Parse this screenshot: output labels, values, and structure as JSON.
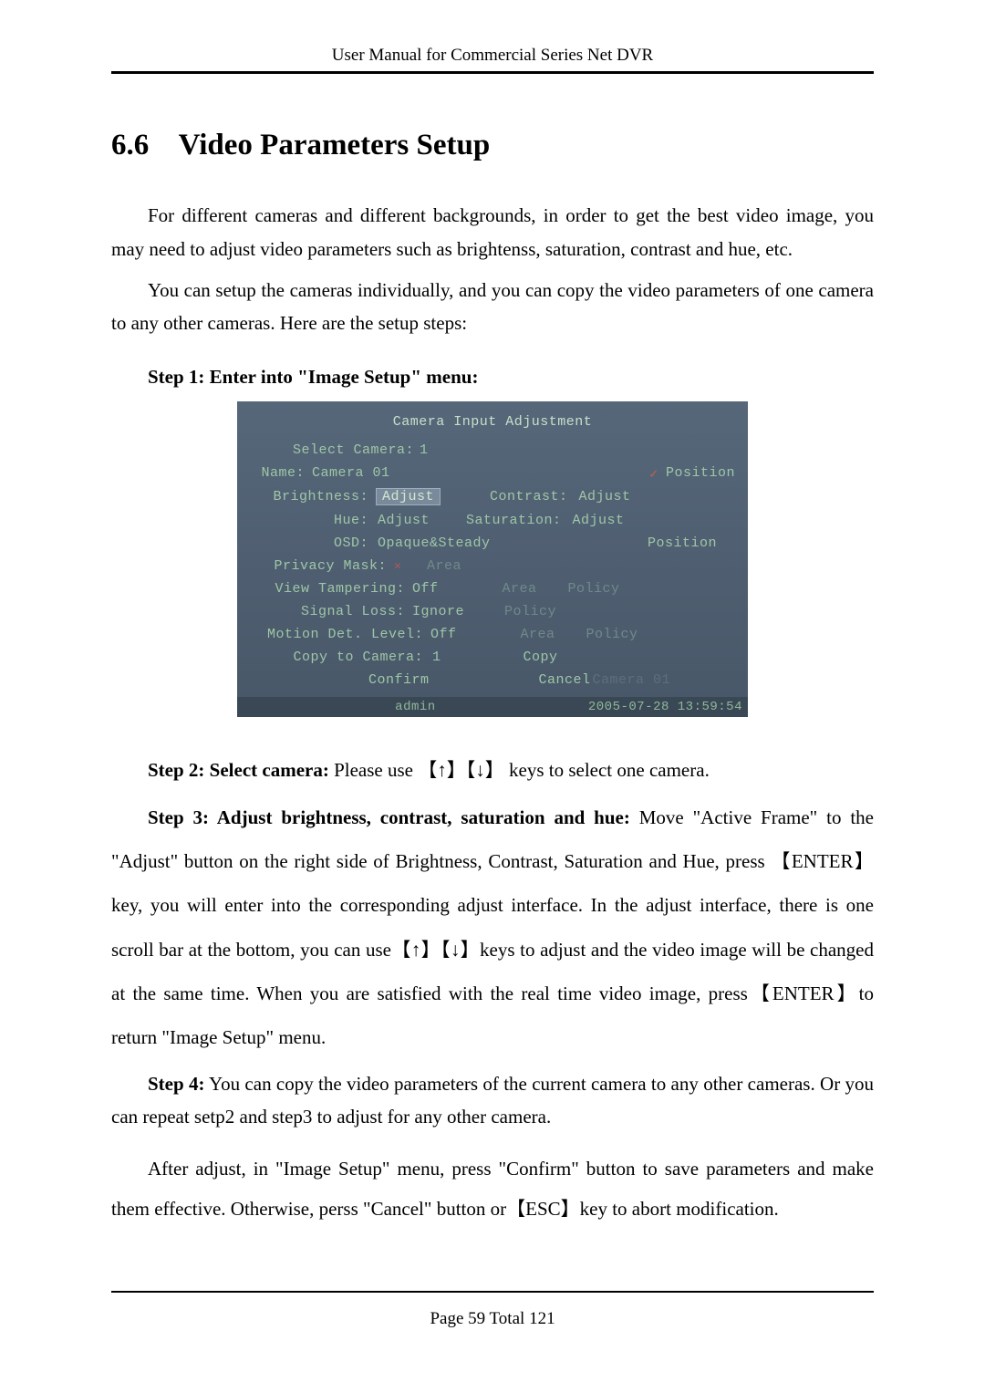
{
  "header": {
    "running_title": "User Manual for Commercial Series Net DVR"
  },
  "section": {
    "number": "6.6",
    "title": "Video Parameters Setup"
  },
  "paragraphs": {
    "p1": "For different cameras and different backgrounds, in order to get the best video image, you may need to adjust video parameters such as brightenss, saturation, contrast and hue, etc.",
    "p2": "You can setup the cameras individually, and you can copy the video parameters of one camera to any other cameras. Here are the setup steps:",
    "step1": "Step 1: Enter into \"Image Setup\" menu:",
    "step2_label": "Step 2: Select camera:",
    "step2_rest_a": " Please use",
    "step2_keys": "【↑】【↓】",
    "step2_rest_b": " keys to select one camera.",
    "step3_label": "Step 3: Adjust brightness, contrast, saturation and hue:",
    "step3_rest": " Move \"Active Frame\" to the \"Adjust\" button on the right side of Brightness, Contrast, Saturation and Hue, press  【ENTER】key, you will enter into the corresponding adjust interface. In the adjust interface, there is one scroll bar at the bottom, you can use【↑】【↓】keys to adjust and the video image will be changed at the same time. When you are satisfied with the real time video image, press【ENTER】to return \"Image Setup\" menu.",
    "step4_label": "Step 4:",
    "step4_rest": " You can copy the video parameters of the current camera to any other cameras. Or you can repeat setp2 and step3 to adjust for any other camera.",
    "p_after": "After adjust, in \"Image Setup\" menu, press \"Confirm\" button to save parameters and make them effective. Otherwise, perss \"Cancel\" button or【ESC】key to abort modification."
  },
  "dvr": {
    "title": "Camera Input Adjustment",
    "select_camera_label": "Select Camera:",
    "select_camera_value": "1",
    "name_label": "Name:",
    "name_value": "Camera 01",
    "position_label": "Position",
    "brightness_label": "Brightness:",
    "brightness_value": "Adjust",
    "contrast_label": "Contrast:",
    "contrast_value": "Adjust",
    "hue_label": "Hue:",
    "hue_value": "Adjust",
    "saturation_label": "Saturation:",
    "saturation_value": "Adjust",
    "osd_label": "OSD:",
    "osd_value": "Opaque&Steady",
    "osd_position": "Position",
    "privacy_mask_label": "Privacy Mask:",
    "privacy_area": "Area",
    "view_tampering_label": "View Tampering:",
    "view_tampering_value": "Off",
    "view_area": "Area",
    "view_policy": "Policy",
    "signal_loss_label": "Signal Loss:",
    "signal_loss_value": "Ignore",
    "signal_policy": "Policy",
    "motion_label": "Motion Det. Level:",
    "motion_value": "Off",
    "motion_area": "Area",
    "motion_policy": "Policy",
    "copy_label": "Copy to Camera:",
    "copy_value": "1",
    "copy_btn": "Copy",
    "confirm": "Confirm",
    "cancel": "Cancel",
    "ghost": "Camera 01",
    "status_user": "admin",
    "status_time": "2005-07-28 13:59:54"
  },
  "footer": {
    "page_label": "Page ",
    "page_current": "59",
    "page_total_label": " Total ",
    "page_total": "121"
  }
}
